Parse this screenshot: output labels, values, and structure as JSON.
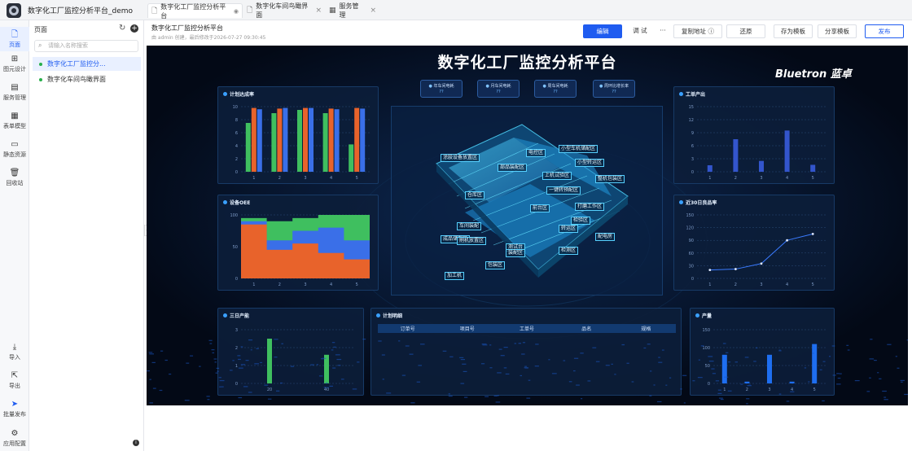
{
  "app": {
    "title": "数字化工厂监控分析平台_demo"
  },
  "tabs": [
    {
      "label": "数字化工厂监控分析平台",
      "icon": "page-icon"
    },
    {
      "label": "数字化车间鸟瞰界面",
      "icon": "page-icon"
    },
    {
      "label": "服务管理",
      "icon": "grid-icon"
    }
  ],
  "nav": [
    {
      "label": "页面",
      "icon": "page-icon"
    },
    {
      "label": "图元设计",
      "icon": "component-icon"
    },
    {
      "label": "服务管理",
      "icon": "service-icon"
    },
    {
      "label": "表单模型",
      "icon": "table-icon"
    },
    {
      "label": "静态资源",
      "icon": "folder-icon"
    },
    {
      "label": "回收站",
      "icon": "trash-icon"
    }
  ],
  "nav_bottom": [
    {
      "label": "导入",
      "icon": "download-icon"
    },
    {
      "label": "导出",
      "icon": "upload-icon"
    },
    {
      "label": "批量发布",
      "icon": "send-icon"
    },
    {
      "label": "应用配置",
      "icon": "gear-icon"
    }
  ],
  "panel": {
    "title": "页面",
    "search_placeholder": "请输入名称搜索",
    "items": [
      "数字化工厂监控分...",
      "数字化车间鸟瞰界面"
    ]
  },
  "header": {
    "page_title": "数字化工厂监控分析平台",
    "meta": "由 admin 创建，最后修改于2026-07-27 09:30:45",
    "buttons": {
      "edit": "编辑",
      "debug": "调 试",
      "more": "···",
      "copy": "复制地址",
      "restore": "还原",
      "save_tpl": "存为模板",
      "share_tpl": "分享模板",
      "publish": "发布"
    }
  },
  "dashboard": {
    "title": "数字化工厂监控分析平台",
    "brand": "Bluetron 蓝卓",
    "kpis": [
      {
        "label": "年车间电耗",
        "value": "??"
      },
      {
        "label": "月车间电耗",
        "value": "??"
      },
      {
        "label": "周车间电耗",
        "value": "??"
      },
      {
        "label": "周环比增长率",
        "value": "??"
      }
    ],
    "cards": {
      "plan": "计划达成率",
      "oee": "设备OEE",
      "output": "工单产出",
      "rate": "近30日良品率",
      "three_day": "三日产能",
      "plan_list": "计划明细",
      "yield": "产量"
    },
    "table_headers": [
      "订单号",
      "项目号",
      "工单号",
      "品名",
      "规格"
    ],
    "zones": [
      "涂胶设备放置区",
      "电控区",
      "小型车机储配区",
      "部品装配区",
      "小型转运区",
      "上机试验区",
      "整机包装区",
      "一键转预配区",
      "仓库区",
      "前台区",
      "打磨工作区",
      "车间装配",
      "转运区",
      "成品储存区",
      "刷机放置区",
      "测试台",
      "装配区",
      "检测区",
      "配电房",
      "包装区",
      "检验区",
      "加工机"
    ]
  },
  "chart_data": [
    {
      "type": "bar",
      "title": "计划达成率",
      "categories": [
        "1",
        "2",
        "3",
        "4",
        "5"
      ],
      "ylim": [
        0,
        10
      ],
      "ticks": [
        "0",
        "2",
        "4",
        "6",
        "8",
        "10"
      ],
      "series": [
        {
          "color": "#3fbf5f",
          "values": [
            7.5,
            9,
            9.5,
            9,
            4.2
          ]
        },
        {
          "color": "#e8632b",
          "values": [
            9.8,
            9.7,
            9.8,
            9.7,
            9.8
          ]
        },
        {
          "color": "#3a6fe8",
          "values": [
            9.6,
            9.8,
            9.8,
            9.6,
            9.7
          ]
        }
      ]
    },
    {
      "type": "area",
      "title": "设备OEE",
      "x": [
        "1",
        "2",
        "3",
        "4",
        "5"
      ],
      "ylim": [
        0,
        100
      ],
      "ticks": [
        "0",
        "50",
        "100"
      ],
      "series": [
        {
          "color": "#3fbf5f",
          "values": [
            95,
            90,
            95,
            100,
            100
          ]
        },
        {
          "color": "#3a6fe8",
          "values": [
            90,
            60,
            75,
            80,
            60
          ]
        },
        {
          "color": "#e8632b",
          "values": [
            85,
            45,
            55,
            40,
            30
          ]
        }
      ]
    },
    {
      "type": "bar",
      "title": "工单产出",
      "categories": [
        "1",
        "2",
        "3",
        "4",
        "5"
      ],
      "ylim": [
        0,
        15
      ],
      "ticks": [
        "0",
        "3",
        "6",
        "9",
        "12",
        "15"
      ],
      "series": [
        {
          "color": "#3355cc",
          "values": [
            1.5,
            7.5,
            2.5,
            9.5,
            1.6
          ]
        }
      ]
    },
    {
      "type": "line",
      "title": "近30日良品率",
      "x": [
        "1",
        "2",
        "3",
        "4",
        "5"
      ],
      "ylim": [
        0,
        150
      ],
      "ticks": [
        "0",
        "30",
        "60",
        "90",
        "120",
        "150"
      ],
      "series": [
        {
          "color": "#3a7bff",
          "values": [
            20,
            22,
            35,
            90,
            105
          ]
        }
      ]
    },
    {
      "type": "bar",
      "title": "三日产能",
      "categories": [
        "20",
        "40"
      ],
      "ylim": [
        0,
        3
      ],
      "ticks": [
        "0",
        "1",
        "2",
        "3"
      ],
      "series": [
        {
          "color": "#3fbf5f",
          "values": [
            2.5,
            1.6
          ]
        }
      ]
    },
    {
      "type": "bar",
      "title": "产量",
      "categories": [
        "1",
        "2",
        "3",
        "4",
        "5"
      ],
      "ylim": [
        0,
        150
      ],
      "ticks": [
        "0",
        "50",
        "100",
        "150"
      ],
      "series": [
        {
          "color": "#1e6ef0",
          "values": [
            80,
            5,
            80,
            5,
            110
          ]
        }
      ]
    }
  ]
}
